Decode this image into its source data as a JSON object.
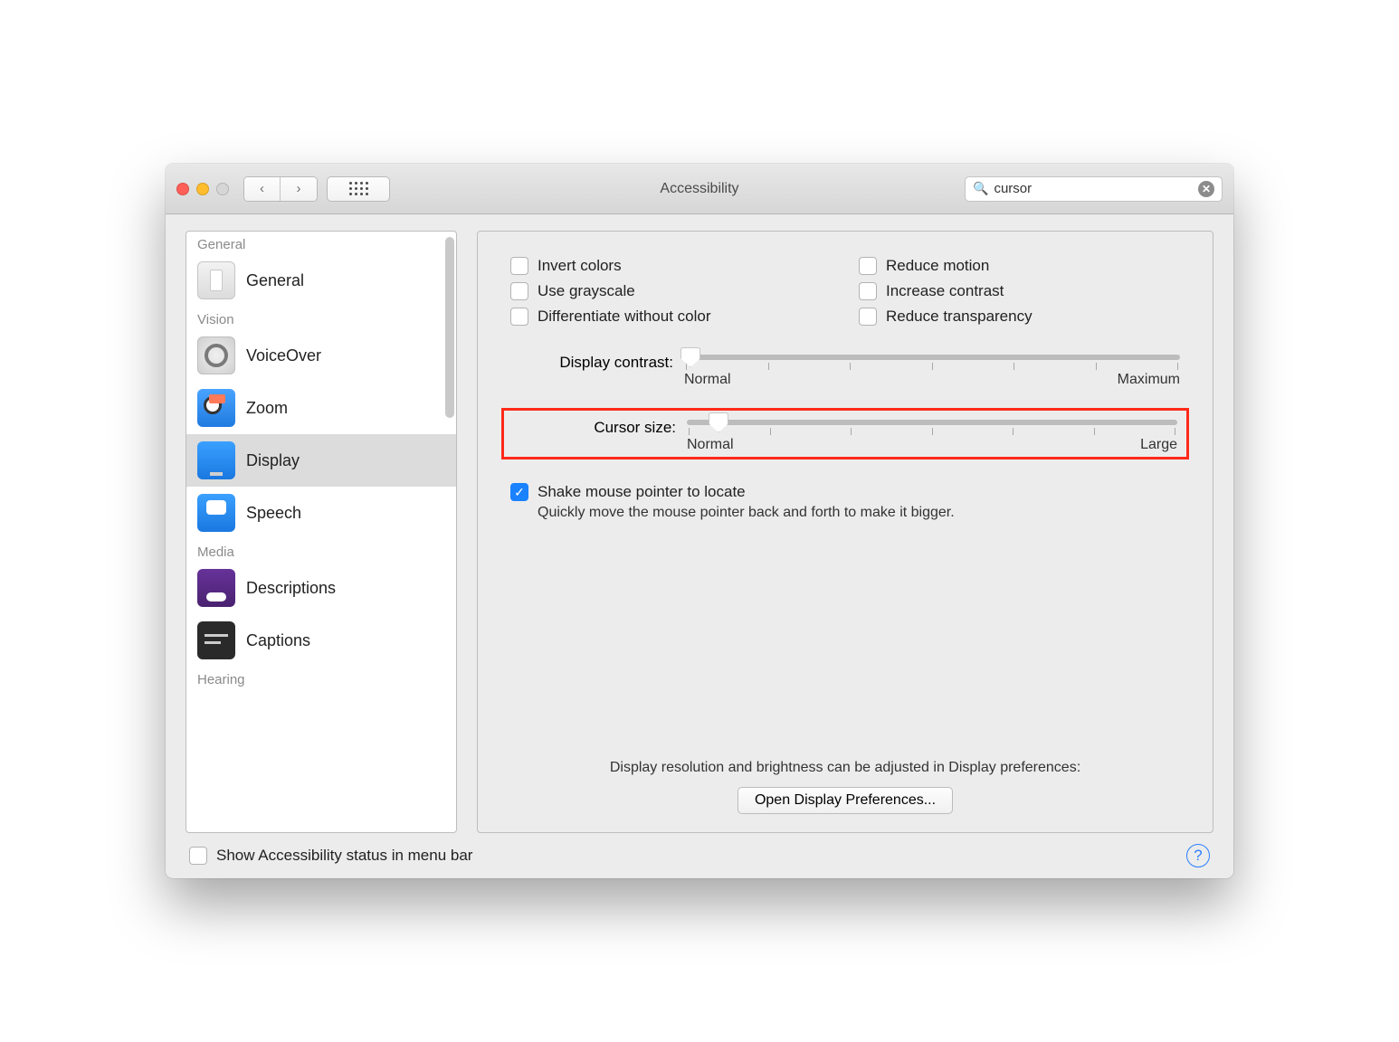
{
  "window": {
    "title": "Accessibility"
  },
  "search": {
    "value": "cursor"
  },
  "sidebar": {
    "sections": [
      {
        "label": "General",
        "items": [
          {
            "label": "General",
            "icon": "general",
            "selected": false
          }
        ]
      },
      {
        "label": "Vision",
        "items": [
          {
            "label": "VoiceOver",
            "icon": "voiceover",
            "selected": false
          },
          {
            "label": "Zoom",
            "icon": "zoom",
            "selected": false
          },
          {
            "label": "Display",
            "icon": "display",
            "selected": true
          },
          {
            "label": "Speech",
            "icon": "speech",
            "selected": false
          }
        ]
      },
      {
        "label": "Media",
        "items": [
          {
            "label": "Descriptions",
            "icon": "desc",
            "selected": false
          },
          {
            "label": "Captions",
            "icon": "captions",
            "selected": false
          }
        ]
      },
      {
        "label": "Hearing",
        "items": []
      }
    ]
  },
  "main": {
    "checks": {
      "invert": {
        "label": "Invert colors",
        "checked": false
      },
      "motion": {
        "label": "Reduce motion",
        "checked": false
      },
      "gray": {
        "label": "Use grayscale",
        "checked": false
      },
      "contrast": {
        "label": "Increase contrast",
        "checked": false
      },
      "diff": {
        "label": "Differentiate without color",
        "checked": false
      },
      "transp": {
        "label": "Reduce transparency",
        "checked": false
      }
    },
    "sliders": {
      "contrast": {
        "label": "Display contrast:",
        "min_label": "Normal",
        "max_label": "Maximum",
        "value_pct": 0
      },
      "cursor": {
        "label": "Cursor size:",
        "min_label": "Normal",
        "max_label": "Large",
        "value_pct": 8
      }
    },
    "shake": {
      "checked": true,
      "label": "Shake mouse pointer to locate",
      "desc": "Quickly move the mouse pointer back and forth to make it bigger."
    },
    "footnote": "Display resolution and brightness can be adjusted in Display preferences:",
    "open_button": "Open Display Preferences..."
  },
  "footer": {
    "status_label": "Show Accessibility status in menu bar",
    "status_checked": false
  }
}
